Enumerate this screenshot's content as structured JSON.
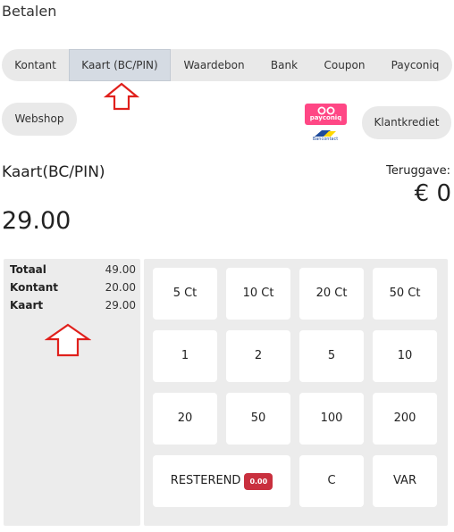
{
  "page": {
    "title": "Betalen"
  },
  "tabs": [
    {
      "label": "Kontant",
      "active": false
    },
    {
      "label": "Kaart (BC/PIN)",
      "active": true
    },
    {
      "label": "Waardebon",
      "active": false
    },
    {
      "label": "Bank",
      "active": false
    },
    {
      "label": "Coupon",
      "active": false
    },
    {
      "label": "Payconiq",
      "active": false
    }
  ],
  "extra_methods": {
    "webshop_label": "Webshop",
    "credit_label": "Klantkrediet",
    "payconiq_logo_text": "payconiq",
    "bancontact_logo_text": "Bancontact"
  },
  "payment": {
    "method": "Kaart(BC/PIN)",
    "amount": "29.00",
    "change_label": "Teruggave:",
    "change_value": "€ 0"
  },
  "summary": [
    {
      "label": "Totaal",
      "value": "49.00"
    },
    {
      "label": "Kontant",
      "value": "20.00"
    },
    {
      "label": "Kaart",
      "value": "29.00"
    }
  ],
  "keypad": {
    "row1": [
      "5 Ct",
      "10 Ct",
      "20 Ct",
      "50 Ct"
    ],
    "row2": [
      "1",
      "2",
      "5",
      "10"
    ],
    "row3": [
      "20",
      "50",
      "100",
      "200"
    ],
    "remaining_label": "RESTEREND",
    "remaining_value": "0.00",
    "clear_label": "C",
    "var_label": "VAR"
  },
  "colors": {
    "accent_arrow": "#e0201c",
    "badge": "#c9303e",
    "payconiq_pink": "#ff4785",
    "active_tab": "#d5dbe3"
  }
}
